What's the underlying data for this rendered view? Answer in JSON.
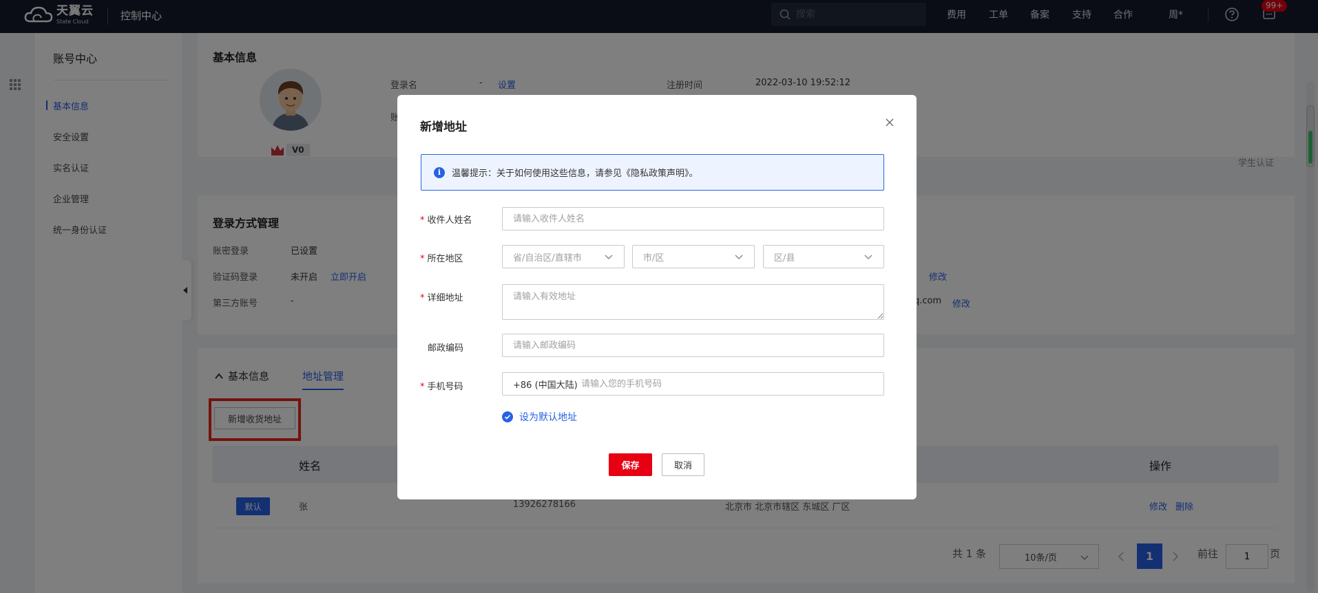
{
  "topbar": {
    "logo_cn": "天翼云",
    "logo_en": "State Cloud",
    "console_title": "控制中心",
    "search_placeholder": "搜索",
    "nav": [
      "费用",
      "工单",
      "备案",
      "支持",
      "合作"
    ],
    "user_label": "周*",
    "msg_count": "99+"
  },
  "sidebar": {
    "title": "账号中心",
    "items": [
      {
        "label": "基本信息",
        "active": true
      },
      {
        "label": "安全设置"
      },
      {
        "label": "实名认证"
      },
      {
        "label": "企业管理"
      },
      {
        "label": "统一身份认证"
      }
    ]
  },
  "basic_info": {
    "title": "基本信息",
    "level": "V0",
    "login_name_label": "登录名",
    "login_name_value": "-",
    "login_name_action": "设置",
    "reg_time_label": "注册时间",
    "reg_time_value": "2022-03-10 19:52:12",
    "account_label_partial": "账",
    "student_auth": "学生认证"
  },
  "login_methods": {
    "title": "登录方式管理",
    "rows": [
      {
        "label": "账密登录",
        "value": "已设置",
        "action": ""
      },
      {
        "label": "验证码登录",
        "value": "未开启",
        "action": "立即开启"
      },
      {
        "label": "第三方账号",
        "value": "-",
        "action": ""
      }
    ],
    "right_partial_1": ")",
    "right_action_1": "修改",
    "right_partial_2": "q.com",
    "right_action_2": "修改"
  },
  "address_section": {
    "tab_basic": "基本信息",
    "tab_address": "地址管理",
    "add_button": "新增收货地址",
    "columns": {
      "name": "姓名",
      "ops": "操作"
    },
    "rows": [
      {
        "tag": "默认",
        "name": "张",
        "phone": "13926278166",
        "address": "北京市 北京市辖区 东城区 厂区",
        "edit": "修改",
        "delete": "删除"
      }
    ],
    "pager": {
      "total": "共 1 条",
      "page_size": "10条/页",
      "current": "1",
      "goto_label": "前往",
      "goto_value": "1",
      "page_suffix": "页"
    }
  },
  "modal": {
    "title": "新增地址",
    "tip_icon": "i",
    "tip_text": "温馨提示：关于如何使用这些信息，请参见《隐私政策声明》。",
    "fields": {
      "name_label": "收件人姓名",
      "name_placeholder": "请输入收件人姓名",
      "region_label": "所在地区",
      "province_placeholder": "省/自治区/直辖市",
      "city_placeholder": "市/区",
      "district_placeholder": "区/县",
      "detail_label": "详细地址",
      "detail_placeholder": "请输入有效地址",
      "zip_label": "邮政编码",
      "zip_placeholder": "请输入邮政编码",
      "phone_label": "手机号码",
      "phone_code": "+86 (中国大陆)",
      "phone_placeholder": "请输入您的手机号码"
    },
    "default_label": "设为默认地址",
    "save": "保存",
    "cancel": "取消"
  },
  "colors": {
    "accent": "#2761e4",
    "brand_red": "#e60012",
    "topbar_bg": "#141b2d"
  }
}
